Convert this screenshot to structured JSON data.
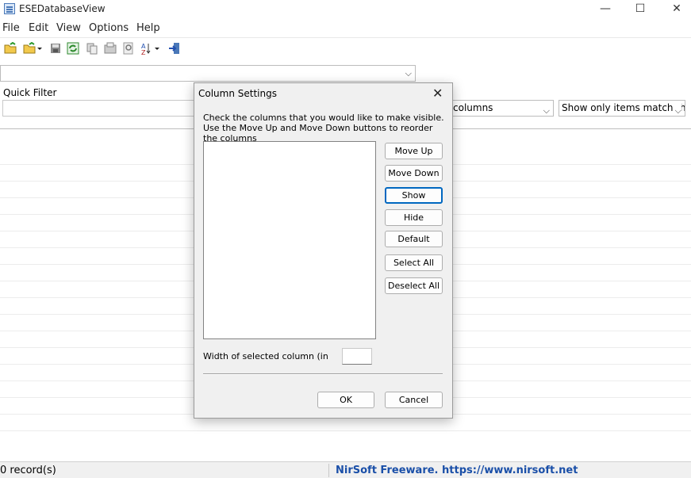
{
  "app": {
    "title": "ESEDatabaseView",
    "window_controls": {
      "minimize": "—",
      "maximize": "☐",
      "close": "✕"
    }
  },
  "menu": [
    "File",
    "Edit",
    "View",
    "Options",
    "Help"
  ],
  "toolbar": {
    "icons": [
      "open-folder-icon",
      "open-dropdown-icon",
      "save-icon",
      "refresh-icon",
      "copy-icon",
      "properties-icon",
      "find-icon",
      "sort-icon",
      "exit-icon"
    ]
  },
  "database_select": {
    "value": ""
  },
  "quick_filter": {
    "label": "Quick Filter",
    "value": "",
    "columns_select": "columns",
    "match_select": "Show only items match the f"
  },
  "status": {
    "record_count": "0 record(s)",
    "link": "NirSoft Freeware. https://www.nirsoft.net"
  },
  "dialog": {
    "title": "Column Settings",
    "close_glyph": "✕",
    "description": "Check the columns that you would like to make visible. Use the Move Up and Move Down buttons to reorder the columns",
    "columns": [],
    "buttons": {
      "move_up": "Move Up",
      "move_down": "Move Down",
      "show": "Show",
      "hide": "Hide",
      "default": "Default",
      "select_all": "Select All",
      "deselect_all": "Deselect All"
    },
    "width_label": "Width of selected column (in",
    "width_value": "",
    "ok": "OK",
    "cancel": "Cancel"
  },
  "colors": {
    "accent": "#0067c0",
    "link": "#1a4fa8"
  }
}
